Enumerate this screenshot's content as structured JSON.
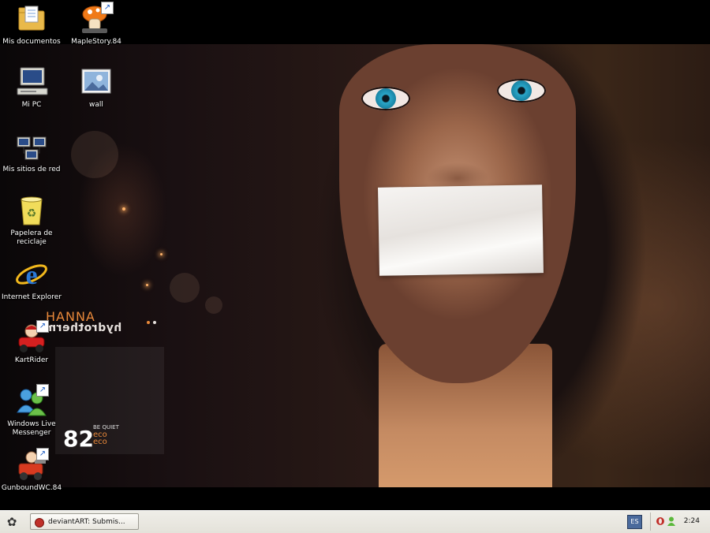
{
  "desktop": {
    "icons": [
      {
        "id": "mis-documentos",
        "label": "Mis documentos",
        "shortcut": false,
        "icon": "folder-documents-icon"
      },
      {
        "id": "maplestory",
        "label": "MapleStory.84",
        "shortcut": true,
        "icon": "maplestory-mushroom-icon"
      },
      {
        "id": "mi-pc",
        "label": "Mi PC",
        "shortcut": false,
        "icon": "computer-icon"
      },
      {
        "id": "wall",
        "label": "wall",
        "shortcut": false,
        "icon": "image-file-icon"
      },
      {
        "id": "mis-sitios-de-red",
        "label": "Mis sitios de red",
        "shortcut": false,
        "icon": "network-places-icon"
      },
      {
        "id": "papelera",
        "label": "Papelera de reciclaje",
        "shortcut": false,
        "icon": "recycle-bin-icon"
      },
      {
        "id": "internet-explorer",
        "label": "Internet Explorer",
        "shortcut": false,
        "icon": "internet-explorer-icon"
      },
      {
        "id": "kartrider",
        "label": "KartRider",
        "shortcut": true,
        "icon": "kartrider-icon"
      },
      {
        "id": "windows-live-messenger",
        "label": "Windows Live Messenger",
        "shortcut": true,
        "icon": "messenger-buddies-icon"
      },
      {
        "id": "gunbound",
        "label": "GunboundWC.84",
        "shortcut": true,
        "icon": "gunbound-icon"
      }
    ]
  },
  "wallpaper": {
    "brand_top": "HANNA",
    "brand_mirror": "hydrotherm",
    "badge_number": "82",
    "badge_tag": "BE QUIET",
    "badge_eco_1": "eco",
    "badge_eco_2": "eco",
    "accent_color": "#e8883a"
  },
  "taskbar": {
    "start_icon": "gnome-foot-icon",
    "start_glyph": "✿",
    "task_button": {
      "label": "deviantART: Submis...",
      "icon": "opera-icon"
    },
    "language": "ES",
    "tray_icons": [
      "opera-icon",
      "messenger-status-icon"
    ],
    "clock": "2:24"
  }
}
